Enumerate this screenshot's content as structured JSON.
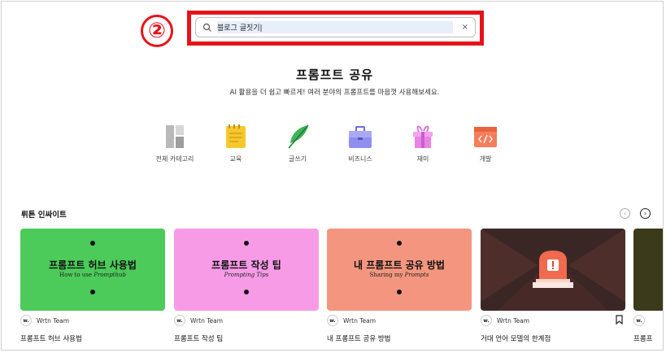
{
  "annotation": {
    "step": "②"
  },
  "search": {
    "query": "블로그 글짓기",
    "clear_icon": "×"
  },
  "header": {
    "title": "프롬프트 공유",
    "subtitle": "AI 활용을 더 쉽고 빠르게! 여러 분야의 프롬프트를 마음껏 사용해보세요."
  },
  "categories": [
    {
      "label": "전체 카테고리",
      "icon": "grid-icon"
    },
    {
      "label": "교육",
      "icon": "notepad-icon"
    },
    {
      "label": "글쓰기",
      "icon": "feather-icon"
    },
    {
      "label": "비즈니스",
      "icon": "briefcase-icon"
    },
    {
      "label": "재미",
      "icon": "gift-icon"
    },
    {
      "label": "개발",
      "icon": "code-window-icon"
    }
  ],
  "insights": {
    "title": "뤼튼 인싸이트",
    "prev_icon": "‹",
    "next_icon": "›",
    "cards": [
      {
        "thumb_title": "프롬프트 허브 사용법",
        "thumb_sub_a": "How to use ",
        "thumb_sub_b": "Prompthub",
        "author": "Wrtn Team",
        "avatar": "w.",
        "name": "프롬프트 허브 사용법",
        "color": "#4cca5a"
      },
      {
        "thumb_title": "프롬프트 작성 팁",
        "thumb_sub_a": "Prompting Tips",
        "thumb_sub_b": "",
        "author": "Wrtn Team",
        "avatar": "w.",
        "name": "프롬프트 작성 팁",
        "color": "#f79be7"
      },
      {
        "thumb_title": "내 프롬프트 공유 방법",
        "thumb_sub_a": "Sharing my ",
        "thumb_sub_b": "Prompts",
        "author": "Wrtn Team",
        "avatar": "w.",
        "name": "내 프롬프트 공유 방법",
        "color": "#f4967f"
      },
      {
        "thumb_title": "",
        "thumb_sub_a": "",
        "thumb_sub_b": "",
        "author": "Wrtn Team",
        "avatar": "w.",
        "name": "거대 언어 모델의 한계점",
        "color": "#3b2626"
      }
    ],
    "partial": {
      "avatar": "w.",
      "name": "프롬프"
    }
  }
}
